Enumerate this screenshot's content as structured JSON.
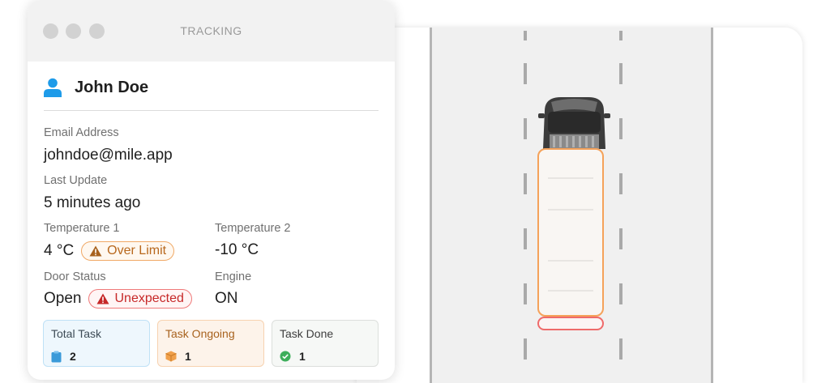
{
  "window": {
    "title": "TRACKING"
  },
  "user": {
    "name": "John Doe"
  },
  "fields": {
    "email_label": "Email Address",
    "email_value": "johndoe@mile.app",
    "last_update_label": "Last Update",
    "last_update_value": "5 minutes ago",
    "temp1_label": "Temperature 1",
    "temp1_value": "4 °C",
    "temp1_badge": "Over Limit",
    "temp2_label": "Temperature 2",
    "temp2_value": "-10 °C",
    "door_label": "Door Status",
    "door_value": "Open",
    "door_badge": "Unexpected",
    "engine_label": "Engine",
    "engine_value": "ON"
  },
  "tasks": [
    {
      "label": "Total Task",
      "count": "2",
      "icon": "clipboard-icon",
      "color": "#3a9ad9"
    },
    {
      "label": "Task Ongoing",
      "count": "1",
      "icon": "package-icon",
      "color": "#f0a04b"
    },
    {
      "label": "Task Done",
      "count": "1",
      "icon": "check-circle-icon",
      "color": "#3dae5b"
    }
  ],
  "colors": {
    "accent_blue": "#1e9be9",
    "warning_orange": "#f0a865",
    "error_red": "#ef7a7a",
    "highlight_orange": "#f5a25a",
    "highlight_red": "#ef6a6a"
  }
}
